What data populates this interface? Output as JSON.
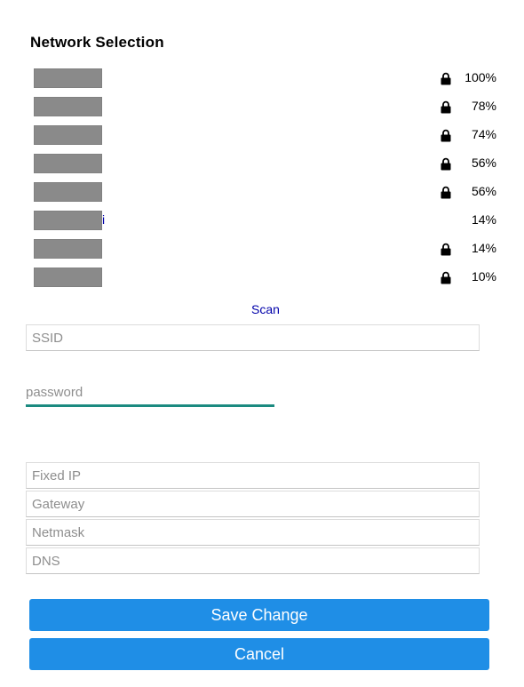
{
  "title": "Network Selection",
  "networks": [
    {
      "ssid_visible": "",
      "locked": true,
      "strength": "100%"
    },
    {
      "ssid_visible": "",
      "locked": true,
      "strength": "78%"
    },
    {
      "ssid_visible": "",
      "locked": true,
      "strength": "74%"
    },
    {
      "ssid_visible": "",
      "locked": true,
      "strength": "56%"
    },
    {
      "ssid_visible": "",
      "locked": true,
      "strength": "56%"
    },
    {
      "ssid_visible": "i",
      "locked": false,
      "strength": "14%"
    },
    {
      "ssid_visible": "",
      "locked": true,
      "strength": "14%"
    },
    {
      "ssid_visible": "",
      "locked": true,
      "strength": "10%"
    }
  ],
  "scan_label": "Scan",
  "form": {
    "ssid_placeholder": "SSID",
    "password_placeholder": "password",
    "fixed_ip_placeholder": "Fixed IP",
    "gateway_placeholder": "Gateway",
    "netmask_placeholder": "Netmask",
    "dns_placeholder": "DNS"
  },
  "buttons": {
    "save_label": "Save Change",
    "cancel_label": "Cancel"
  },
  "colors": {
    "button": "#1f8ee6",
    "link": "#0000aa",
    "password_underline": "#1b8a80",
    "redaction": "#8a8a8a"
  },
  "icons": {
    "lock": "lock-icon"
  }
}
